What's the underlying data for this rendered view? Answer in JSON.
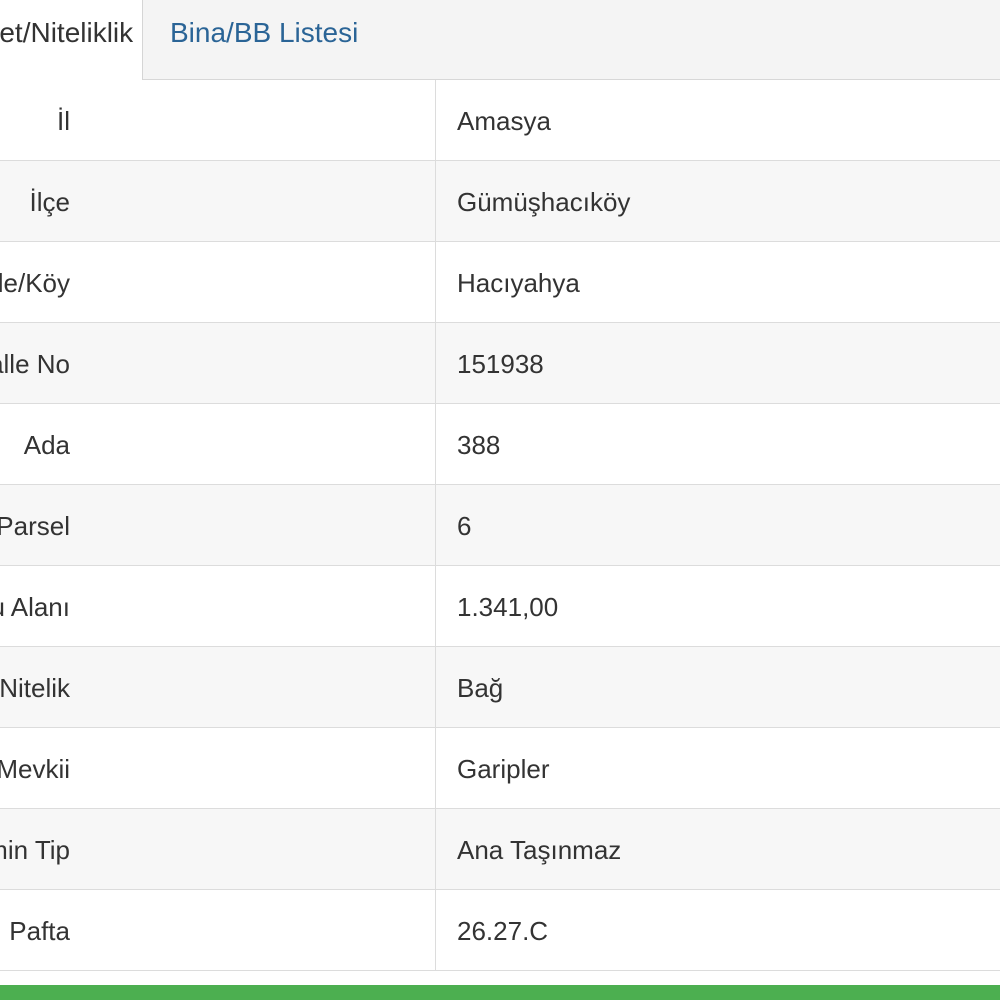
{
  "tabs": [
    {
      "label": "Mülkiyet/Niteliklik Bilgisi",
      "visible_label": "Nitelik Bilgisi"
    },
    {
      "label": "Bina/BB Listesi"
    }
  ],
  "rows": [
    {
      "label": "İl",
      "value": "Amasya"
    },
    {
      "label": "İlçe",
      "value": "Gümüşhacıköy"
    },
    {
      "label": "Mahalle/Köy",
      "value": "Hacıyahya"
    },
    {
      "label": "Mahalle No",
      "value": "151938"
    },
    {
      "label": "Ada",
      "value": "388"
    },
    {
      "label": "Parsel",
      "value": "6"
    },
    {
      "label": "Tapu Alanı",
      "value": "1.341,00"
    },
    {
      "label": "Nitelik",
      "value": "Bağ"
    },
    {
      "label": "Mevkii",
      "value": "Garipler"
    },
    {
      "label": "Zemin Tip",
      "value": "Ana Taşınmaz"
    },
    {
      "label": "Pafta",
      "value": "26.27.C"
    }
  ],
  "colors": {
    "tab_link": "#2a6496",
    "bottom_bar": "#4caf50"
  }
}
